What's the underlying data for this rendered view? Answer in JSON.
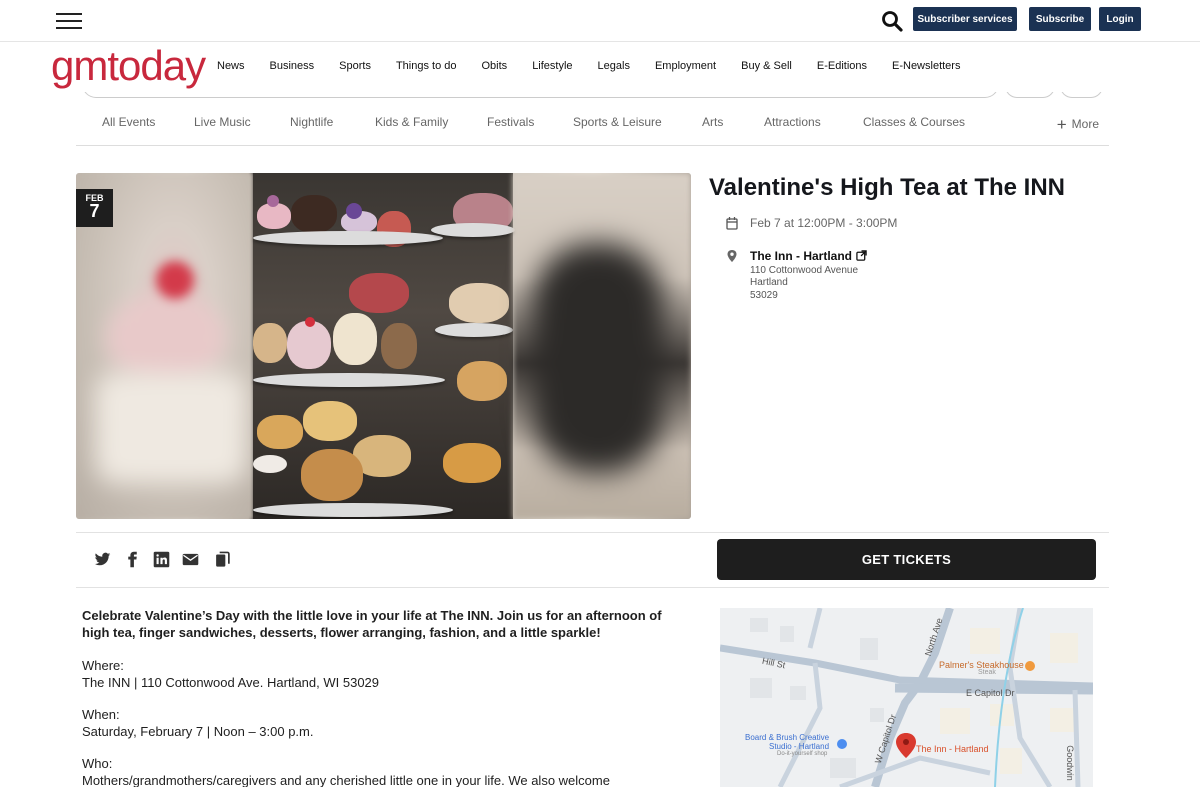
{
  "topbar": {
    "menu_icon": "hamburger-icon",
    "search_icon": "search-icon",
    "subscriber_services": "Subscriber services",
    "subscribe": "Subscribe",
    "login": "Login",
    "button_color": "#1b3253"
  },
  "brand": {
    "logo_text": "gmtoday",
    "logo_color": "#c8283d"
  },
  "main_nav": [
    "News",
    "Business",
    "Sports",
    "Things to do",
    "Obits",
    "Lifestyle",
    "Legals",
    "Employment",
    "Buy & Sell",
    "E-Editions",
    "E-Newsletters"
  ],
  "categories": [
    "All Events",
    "Live Music",
    "Nightlife",
    "Kids & Family",
    "Festivals",
    "Sports & Leisure",
    "Arts",
    "Attractions",
    "Classes & Courses"
  ],
  "categories_more": "More",
  "event": {
    "badge_month": "FEB",
    "badge_day": "7",
    "title": "Valentine's High Tea at The INN",
    "datetime": "Feb 7 at 12:00PM - 3:00PM",
    "venue_name": "The Inn - Hartland",
    "address_line1": "110 Cottonwood Avenue",
    "address_city": "Hartland",
    "address_zip": "53029"
  },
  "share_icons": [
    "twitter-icon",
    "facebook-icon",
    "linkedin-icon",
    "email-icon",
    "copy-icon"
  ],
  "tickets_label": "GET TICKETS",
  "description": {
    "lead": "Celebrate Valentine’s Day with the little love in your life at The INN. Join us for an afternoon of high tea, finger sandwiches, desserts, flower arranging, fashion, and a little sparkle!",
    "where_label": "Where:",
    "where_value": "The INN | 110 Cottonwood Ave. Hartland, WI 53029",
    "when_label": "When:",
    "when_value": "Saturday, February 7 | Noon –  3:00 p.m.",
    "who_label": "Who:",
    "who_value": "Mothers/grandmothers/caregivers and any cherished little one in your life. We also welcome"
  },
  "map": {
    "streets": [
      "Hill St",
      "North Ave",
      "E Capitol Dr",
      "W Capitol Dr",
      "Goodwin"
    ],
    "poi_steakhouse": "Palmer's Steakhouse",
    "poi_steakhouse_sub": "Steak",
    "poi_board": "Board & Brush Creative",
    "poi_board_line2": "Studio - Hartland",
    "poi_board_sub": "Do-it-yourself shop",
    "pin_label": "The Inn - Hartland",
    "pin_color": "#d93a2f"
  }
}
